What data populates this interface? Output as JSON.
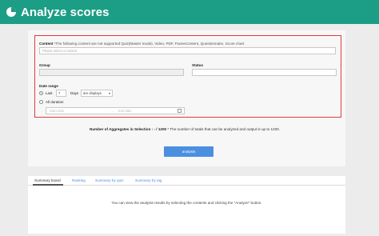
{
  "header": {
    "title": "Analyze scores",
    "logo_icon": "pie-chart-icon"
  },
  "form": {
    "content_label": "Content",
    "content_note": "*The following content are not supported Quiz(Master mode), Video, PDF, FrameContent, Questionnaire, Score chart",
    "content_placeholder": "Please select a content",
    "group_label": "Group",
    "status_label": "Status",
    "date_range_label": "Date range",
    "last_label": "Last",
    "last_value": "7",
    "days_label": "Days",
    "display_select": "are displays",
    "all_duration_label": "All duration",
    "start_date_placeholder": "Start date",
    "arrow": "→",
    "end_date_placeholder": "End date"
  },
  "aggregates": {
    "label": "Number of Aggregates in Selection : - / 1200",
    "note": "* The number of totals that can be analyzed and output is up to 1200."
  },
  "analysis_button": "analysis",
  "tabs": [
    "Summary board",
    "Ranking",
    "Summary by quiz",
    "Summary by tag"
  ],
  "empty_message": "You can view the analysis results by selecting the contents and clicking the \"Analyze\" button.",
  "colors": {
    "header": "#1c9d85",
    "accent": "#4a8fe0",
    "highlight_border": "#e03a3a"
  }
}
